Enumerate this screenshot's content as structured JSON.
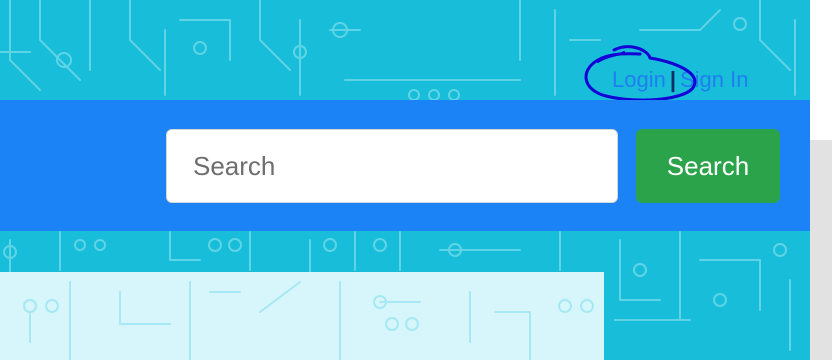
{
  "header": {
    "login_label": "Login",
    "separator": "|",
    "signin_label": "Sign In"
  },
  "navbar": {
    "search_placeholder": "Search",
    "search_button_label": "Search"
  },
  "colors": {
    "background": "#18bdd9",
    "navbar": "#1b83f5",
    "search_button": "#2ba34a",
    "link": "#1f7ef0",
    "content_panel": "#d6f6fb",
    "annotation": "#1400d6"
  }
}
